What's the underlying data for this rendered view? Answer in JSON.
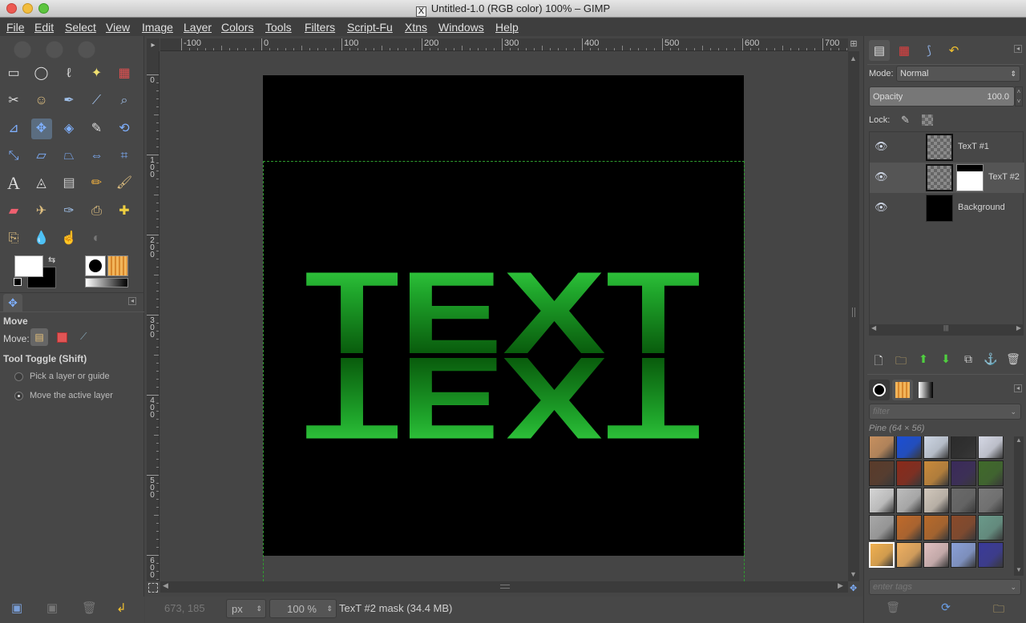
{
  "window": {
    "title": "Untitled-1.0 (RGB color) 100% – GIMP",
    "x_glyph": "X"
  },
  "menu": [
    "File",
    "Edit",
    "Select",
    "View",
    "Image",
    "Layer",
    "Colors",
    "Tools",
    "Filters",
    "Script-Fu",
    "Xtns",
    "Windows",
    "Help"
  ],
  "toolbox": {
    "tools": [
      "rect-select-icon",
      "ellipse-select-icon",
      "free-select-icon",
      "fuzzy-select-icon",
      "select-by-color-icon",
      "scissors-icon",
      "foreground-select-icon",
      "paths-icon",
      "color-picker-icon",
      "zoom-icon",
      "measure-icon",
      "move-icon",
      "align-icon",
      "crop-icon",
      "rotate-icon",
      "scale-icon",
      "shear-icon",
      "perspective-icon",
      "flip-icon",
      "cage-icon",
      "text-icon",
      "bucket-fill-icon",
      "blend-icon",
      "pencil-icon",
      "paintbrush-icon",
      "eraser-icon",
      "airbrush-icon",
      "ink-icon",
      "clone-icon",
      "heal-icon",
      "perspective-clone-icon",
      "blur-icon",
      "smudge-icon",
      "dodge-burn-icon"
    ],
    "colors": {
      "foreground": "#ffffff",
      "background": "#000000"
    },
    "options": {
      "title": "Move",
      "move_label": "Move:",
      "toggle_label": "Tool Toggle  (Shift)",
      "radio1": "Pick a layer or guide",
      "radio2": "Move the active layer",
      "selected_radio": 2
    }
  },
  "ruler": {
    "h_labels": [
      "-100",
      "0",
      "100",
      "200",
      "300",
      "400",
      "500",
      "600",
      "700"
    ],
    "v_labels": [
      "0",
      "100",
      "200",
      "300",
      "400",
      "500",
      "600"
    ]
  },
  "canvas": {
    "text_top": "TEXT",
    "text_color": "#33d43f",
    "text_dark": "#004d00",
    "image_bg": "#000000"
  },
  "status": {
    "coords": "673, 185",
    "unit": "px",
    "zoom": "100 %",
    "message": "TexT #2 mask (34.4 MB)"
  },
  "layers_panel": {
    "mode_label": "Mode:",
    "mode_value": "Normal",
    "opacity_label": "Opacity",
    "opacity_value": "100.0",
    "lock_label": "Lock:",
    "layers": [
      {
        "name": "TexT #1",
        "selected": false
      },
      {
        "name": "TexT #2",
        "selected": true
      },
      {
        "name": "Background",
        "selected": false
      }
    ]
  },
  "patterns_panel": {
    "filter_placeholder": "filter",
    "pattern_name": "Pine (64 × 56)",
    "tags_placeholder": "enter tags",
    "swatches": [
      "#c9915f",
      "#1a4fd8",
      "#cfd8e6",
      "#2b2b2b",
      "#d8dbe8",
      "#5a3b2a",
      "#8a2a1a",
      "#c98a3a",
      "#3a2a5a",
      "#3f6a2a",
      "#d6d6d6",
      "#bdbdbd",
      "#d2c8bc",
      "#6a6a6a",
      "#7a7a7a",
      "#a8a8a8",
      "#c06a2a",
      "#b86a2a",
      "#8a4a2a",
      "#6a9a8a",
      "#f1b04f",
      "#f0b060",
      "#e0c0c0",
      "#8aa0d8",
      "#3a3a9a"
    ]
  }
}
